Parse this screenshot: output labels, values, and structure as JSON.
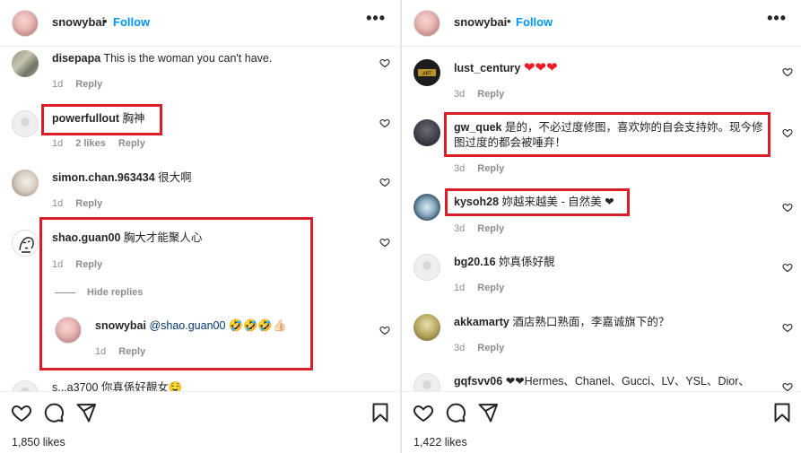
{
  "left": {
    "header": {
      "username": "snowybai",
      "separator": "•",
      "follow_label": "Follow",
      "more_label": "•••"
    },
    "comments": [
      {
        "user": "disepapa",
        "text": "This is the woman you can't have.",
        "time": "1d",
        "reply": "Reply"
      },
      {
        "user": "powerfullout",
        "text": "胸神",
        "time": "1d",
        "likes": "2 likes",
        "reply": "Reply"
      },
      {
        "user": "simon.chan.963434",
        "text": "很大啊",
        "time": "1d",
        "reply": "Reply"
      },
      {
        "user": "shao.guan00",
        "text": "胸大才能聚人心",
        "time": "1d",
        "reply": "Reply"
      }
    ],
    "hide_replies": "Hide replies",
    "reply_comment": {
      "user": "snowybai",
      "mention": "@shao.guan00",
      "emojis": "🤣🤣🤣👍🏻",
      "time": "1d",
      "reply": "Reply"
    },
    "partial_comment": "s...a3700 你真係好靚女🤤",
    "likes": "1,850 likes"
  },
  "right": {
    "header": {
      "username": "snowybai",
      "separator": "•",
      "follow_label": "Follow",
      "more_label": "•••"
    },
    "comments": [
      {
        "user": "lust_century",
        "text": "❤❤❤",
        "time": "3d",
        "reply": "Reply"
      },
      {
        "user": "gw_quek",
        "text": "是的，不必过度修图，喜欢妳的自会支持妳。现今修图过度的都会被唾弃！",
        "time": "3d",
        "reply": "Reply"
      },
      {
        "user": "kysoh28",
        "text": "妳越来越美 - 自然美 ❤",
        "time": "3d",
        "reply": "Reply"
      },
      {
        "user": "bg20.16",
        "text": "妳真係好靚",
        "time": "1d",
        "reply": "Reply"
      },
      {
        "user": "akkamarty",
        "text": "酒店熟口熟面，李嘉诚旗下的？",
        "time": "3d",
        "reply": "Reply"
      },
      {
        "user": "gqfsvv06",
        "text": "❤❤Hermes、Chanel、Gucci、LV、YSL、Dior、",
        "time": "",
        "reply": ""
      }
    ],
    "likes": "1,422 likes"
  },
  "colors": {
    "accent_blue": "#0095f6",
    "highlight_red": "#d81e27",
    "heart_red": "#ed1b24",
    "muted": "#8e8e8e"
  },
  "icons": [
    "heart-icon",
    "comment-icon",
    "share-icon",
    "bookmark-icon",
    "more-icon"
  ]
}
